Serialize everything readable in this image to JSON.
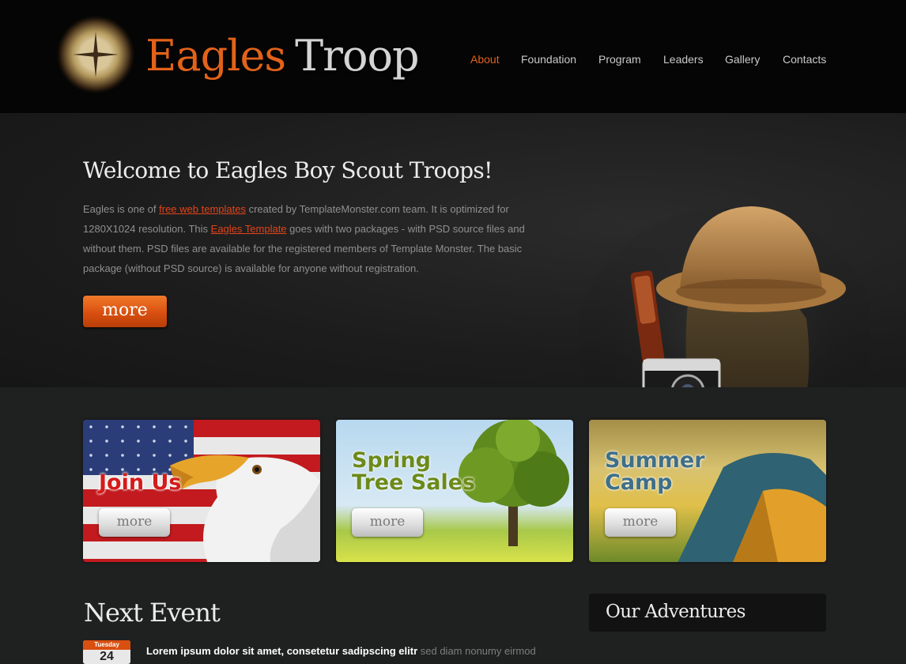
{
  "header": {
    "logo_part1": "Eagles",
    "logo_part2": "Troop",
    "nav": [
      "About",
      "Foundation",
      "Program",
      "Leaders",
      "Gallery",
      "Contacts"
    ],
    "active_nav": "About"
  },
  "hero": {
    "title": "Welcome to Eagles Boy Scout Troops!",
    "text_1": "Eagles is one of ",
    "link_1": "free web templates",
    "text_2": " created by TemplateMonster.com team. It is optimized for 1280X1024 resolution. This ",
    "link_2": "Eagles Template",
    "text_3": " goes with two packages - with PSD source files and without them. PSD files are available for the registered members of Template Monster. The basic package (without PSD source) is available for anyone without registration.",
    "more_label": "more"
  },
  "banners": [
    {
      "title_line1": "Join Us",
      "title_line2": "",
      "more_label": "more"
    },
    {
      "title_line1": "Spring",
      "title_line2": "Tree Sales",
      "more_label": "more"
    },
    {
      "title_line1": "Summer",
      "title_line2": "Camp",
      "more_label": "more"
    }
  ],
  "next_event": {
    "title": "Next Event",
    "calendar_day": "Tuesday",
    "calendar_num": "24",
    "text_strong": "Lorem ipsum dolor sit amet, consetetur sadipscing elitr",
    "text_rest": " sed diam nonumy eirmod"
  },
  "sidebar": {
    "title": "Our Adventures"
  },
  "colors": {
    "accent": "#e2621a",
    "header_bg": "#050505",
    "body_bg": "#1e1f1f"
  }
}
